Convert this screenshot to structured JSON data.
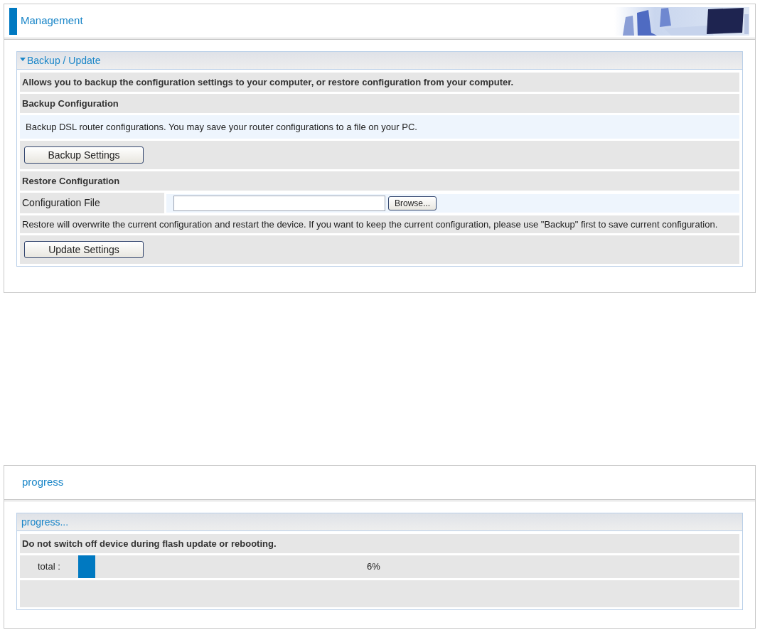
{
  "panels": [
    {
      "title": "Management",
      "kind": "management",
      "section": {
        "title": "Backup / Update",
        "expanded": true,
        "rows": [
          {
            "kind": "note",
            "text": "Allows you to backup the configuration settings to your computer, or restore configuration from your computer."
          },
          {
            "kind": "heading",
            "text": "Backup Configuration"
          },
          {
            "kind": "info",
            "text": "Backup DSL router configurations. You may save your router configurations to a file on your PC."
          },
          {
            "kind": "button",
            "label": "Backup Settings"
          },
          {
            "kind": "heading",
            "text": "Restore Configuration"
          },
          {
            "kind": "file",
            "label": "Configuration File",
            "browse": "Browse..."
          },
          {
            "kind": "text",
            "text": "Restore will overwrite the current configuration and restart the device. If you want to keep the current configuration, please use \"Backup\" first to save current configuration."
          },
          {
            "kind": "button",
            "label": "Update Settings"
          }
        ]
      }
    },
    {
      "title": "progress",
      "kind": "progress",
      "section": {
        "title": "progress...",
        "rows": [
          {
            "kind": "note",
            "text": "Do not switch off device during flash update or rebooting."
          },
          {
            "kind": "progress",
            "label": "total :",
            "level": 0.06,
            "reading": "6%"
          },
          {
            "kind": "blank"
          }
        ]
      }
    }
  ]
}
